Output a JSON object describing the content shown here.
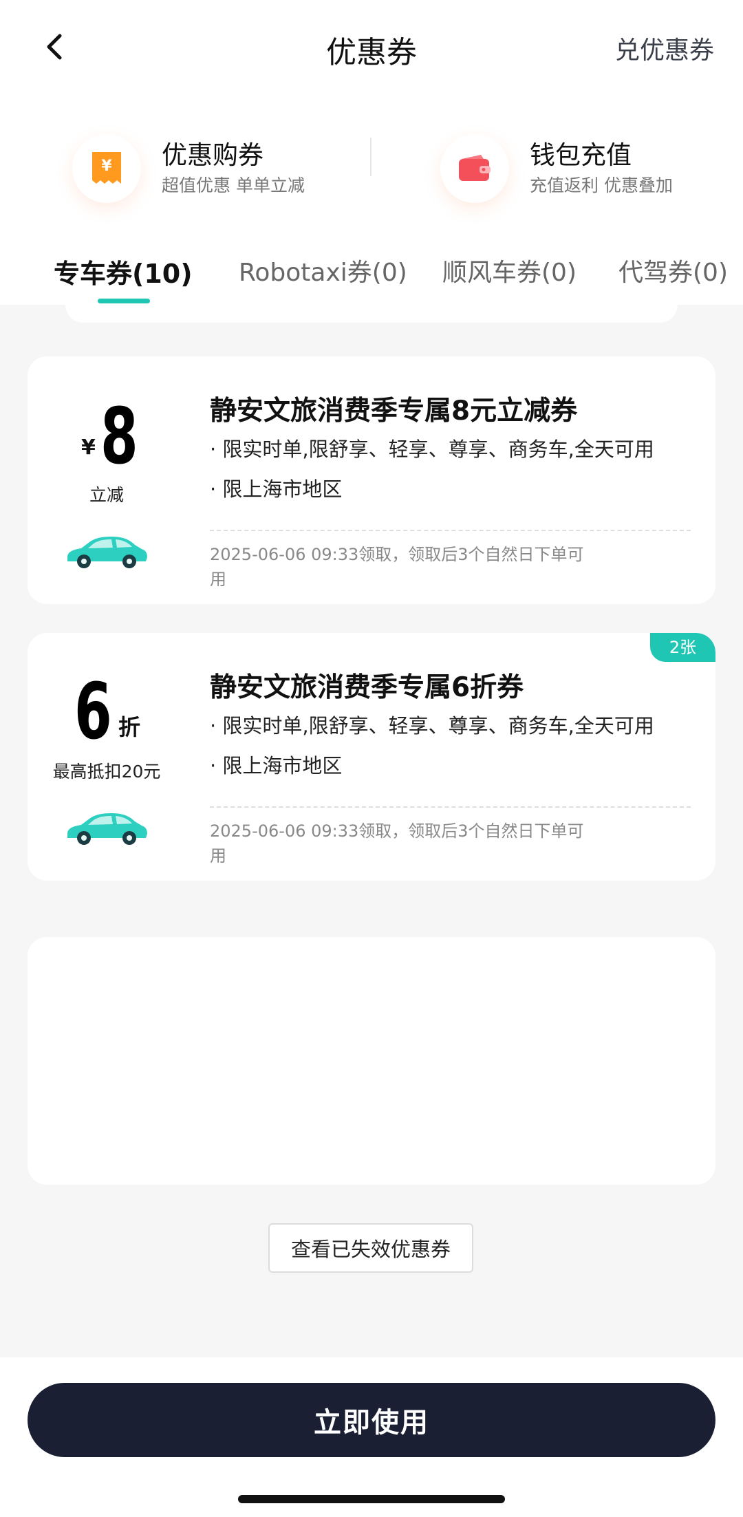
{
  "header": {
    "title": "优惠券",
    "redeem_label": "兑优惠券"
  },
  "promos": [
    {
      "title": "优惠购券",
      "subtitle": "超值优惠 单单立减",
      "icon": "yen-ticket-icon",
      "color": "#ff9a1f"
    },
    {
      "title": "钱包充值",
      "subtitle": "充值返利 优惠叠加",
      "icon": "wallet-icon",
      "color": "#f4505a"
    }
  ],
  "tabs": [
    {
      "label": "专车券(10)",
      "active": true
    },
    {
      "label": "Robotaxi券(0)",
      "active": false
    },
    {
      "label": "顺风车券(0)",
      "active": false
    },
    {
      "label": "代驾券(0)",
      "active": false
    }
  ],
  "coupons": [
    {
      "currency": "¥",
      "value": "8",
      "value_sub": "立减",
      "title": "静安文旅消费季专属8元立减券",
      "rules": [
        "· 限实时单,限舒享、轻享、尊享、商务车,全天可用",
        "· 限上海市地区"
      ],
      "footer": "2025-06-06 09:33领取，领取后3个自然日下单可用"
    },
    {
      "value": "6",
      "unit": "折",
      "value_sub": "最高抵扣20元",
      "badge": "2张",
      "title": "静安文旅消费季专属6折券",
      "rules": [
        "· 限实时单,限舒享、轻享、尊享、商务车,全天可用",
        "· 限上海市地区"
      ],
      "footer": "2025-06-06 09:33领取，领取后3个自然日下单可用"
    }
  ],
  "expired_button": "查看已失效优惠券",
  "use_button": "立即使用",
  "colors": {
    "accent": "#1fc6b4",
    "car": "#2ccfc0",
    "primary_button": "#1b1f33",
    "background": "#f6f6f6"
  }
}
